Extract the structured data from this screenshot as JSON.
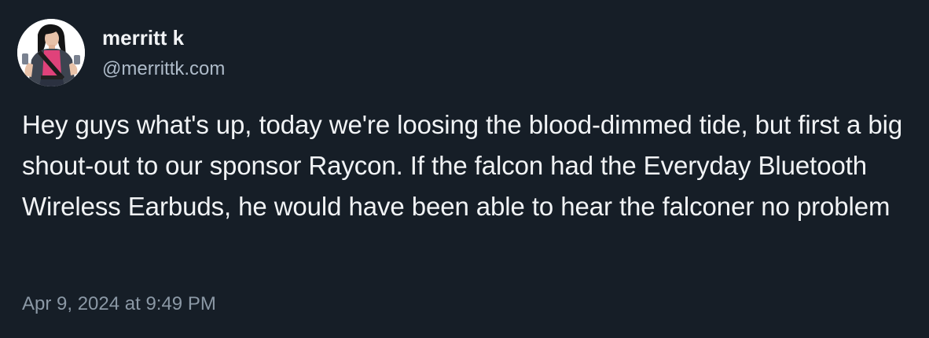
{
  "post": {
    "author": {
      "display_name": "merritt k",
      "handle": "@merrittk.com",
      "avatar_icon": "avatar-illustration-icon"
    },
    "text": "Hey guys what's up, today we're loosing the blood-dimmed tide, but first a big shout-out to our sponsor Raycon. If the falcon had the Everyday Bluetooth Wireless Earbuds, he would have been able to hear the falconer no problem",
    "timestamp": "Apr 9, 2024 at 9:49 PM"
  },
  "colors": {
    "background": "#161e27",
    "text_primary": "#f1f3f5",
    "text_secondary": "#aebbc9",
    "timestamp": "#8b98a5",
    "avatar_accent": "#e0427a"
  }
}
